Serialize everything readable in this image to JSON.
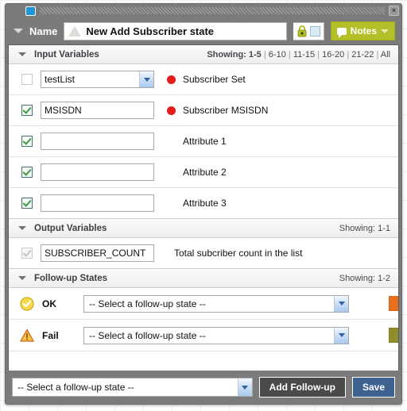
{
  "window": {
    "app_icon": "app-window-icon",
    "close_label": "×"
  },
  "namebar": {
    "label": "Name",
    "state_name": "New Add Subscriber state",
    "lock_icon": "lock-icon",
    "notes_label": "Notes"
  },
  "colors": {
    "titlebar": "#7b7b7b",
    "notes_button": "#b5bf28",
    "save_button": "#3f6391",
    "add_button": "#4a4a4a",
    "required_dot": "#e81b1b",
    "ok_swatch": "#e8701a",
    "fail_swatch": "#8f8c2a",
    "check_green": "#3e9b42"
  },
  "input_section": {
    "title": "Input Variables",
    "showing_label": "Showing:",
    "pages": [
      "1-5",
      "6-10",
      "11-15",
      "16-20",
      "21-22",
      "All"
    ],
    "active_page": "1-5",
    "rows": [
      {
        "checked": false,
        "control": "select",
        "value": "testList",
        "required": true,
        "label": "Subscriber Set"
      },
      {
        "checked": true,
        "control": "text",
        "value": "MSISDN",
        "required": true,
        "label": "Subscriber MSISDN"
      },
      {
        "checked": true,
        "control": "text",
        "value": "",
        "required": false,
        "label": "Attribute 1"
      },
      {
        "checked": true,
        "control": "text",
        "value": "",
        "required": false,
        "label": "Attribute 2"
      },
      {
        "checked": true,
        "control": "text",
        "value": "",
        "required": false,
        "label": "Attribute 3"
      }
    ]
  },
  "output_section": {
    "title": "Output Variables",
    "showing": "Showing: 1-1",
    "rows": [
      {
        "checked": true,
        "disabled": true,
        "value": "SUBSCRIBER_COUNT",
        "label": "Total subcriber count in the list"
      }
    ]
  },
  "followup_section": {
    "title": "Follow-up States",
    "showing": "Showing: 1-2",
    "rows": [
      {
        "icon": "ok-check-circle-icon",
        "name": "OK",
        "select_value": "-- Select a follow-up state --",
        "swatch": "#e8701a"
      },
      {
        "icon": "warning-triangle-icon",
        "name": "Fail",
        "select_value": "-- Select a follow-up state --",
        "swatch": "#8f8c2a"
      }
    ]
  },
  "footer": {
    "select_value": "-- Select a follow-up state --",
    "add_label": "Add Follow-up",
    "save_label": "Save"
  }
}
